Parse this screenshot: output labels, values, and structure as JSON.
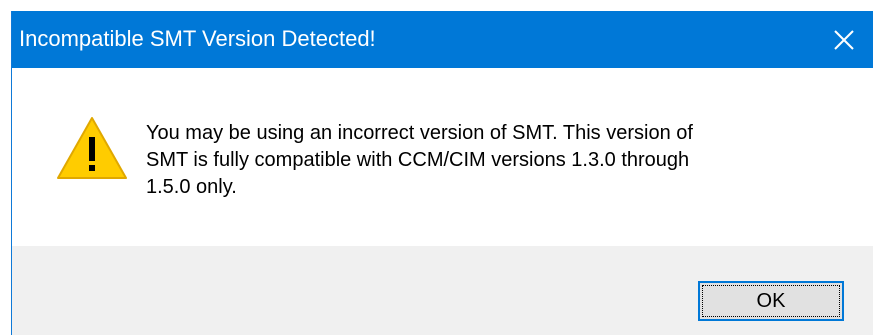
{
  "dialog": {
    "title": "Incompatible SMT Version Detected!",
    "close_icon": "close-icon",
    "warning_icon": "warning-icon",
    "message_line1": "You may be using an incorrect version of SMT. This version of",
    "message_line2": "SMT is fully compatible with CCM/CIM versions 1.3.0 through",
    "message_line3": "1.5.0 only.",
    "ok_label": "OK"
  },
  "colors": {
    "titlebar": "#0078d7",
    "footer": "#f0f0f0",
    "warning_fill": "#ffcc00",
    "button_face": "#e1e1e1",
    "button_border": "#0078d7"
  }
}
